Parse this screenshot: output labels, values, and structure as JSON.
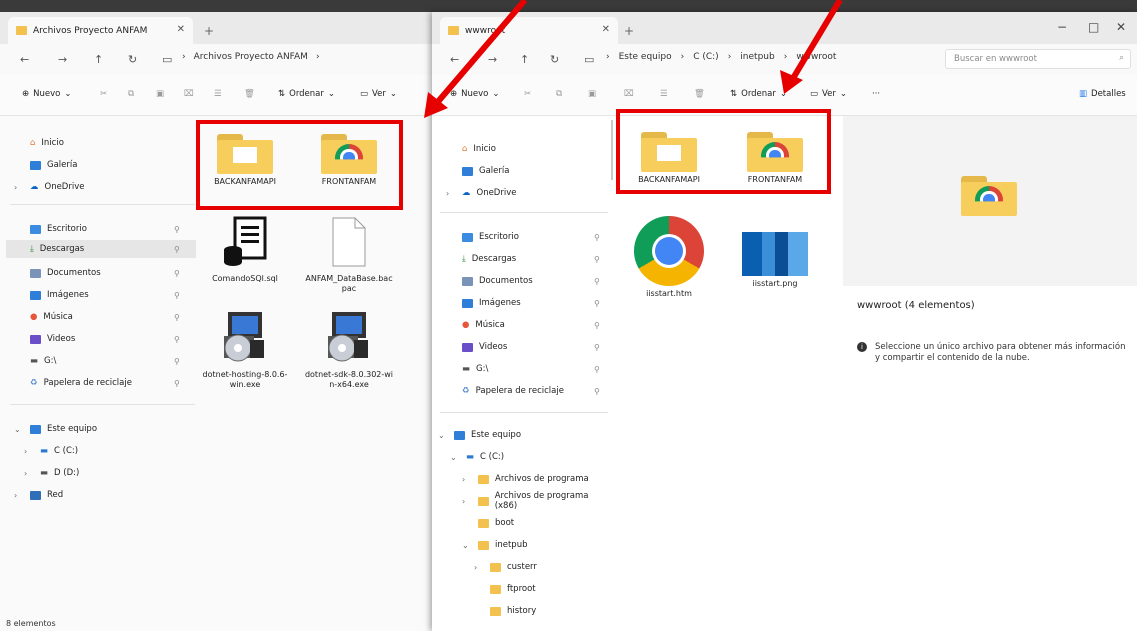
{
  "left_window": {
    "tab_title": "Archivos Proyecto ANFAM",
    "breadcrumb": [
      "Archivos Proyecto ANFAM"
    ],
    "toolbar": {
      "new": "Nuevo",
      "sort": "Ordenar",
      "view": "Ver"
    },
    "nav": {
      "home": "Inicio",
      "gallery": "Galería",
      "onedrive": "OneDrive",
      "desktop": "Escritorio",
      "downloads": "Descargas",
      "documents": "Documentos",
      "images": "Imágenes",
      "music": "Música",
      "videos": "Videos",
      "g_drive": "G:\\",
      "recycle": "Papelera de reciclaje",
      "this_pc": "Este equipo",
      "c_drive": "C (C:)",
      "d_drive": "D (D:)",
      "network": "Red"
    },
    "files": [
      {
        "name": "BACKANFAMAPI",
        "type": "folder"
      },
      {
        "name": "FRONTANFAM",
        "type": "folder-chrome"
      },
      {
        "name": "ComandoSQl.sql",
        "type": "sql"
      },
      {
        "name": "ANFAM_DataBase.bacpac",
        "type": "file"
      },
      {
        "name": "dotnet-hosting-8.0.6-win.exe",
        "type": "installer"
      },
      {
        "name": "dotnet-sdk-8.0.302-win-x64.exe",
        "type": "installer"
      }
    ],
    "status": "8 elementos"
  },
  "right_window": {
    "tab_title": "wwwroot",
    "breadcrumb": [
      "Este equipo",
      "C (C:)",
      "inetpub",
      "wwwroot"
    ],
    "search_placeholder": "Buscar en wwwroot",
    "toolbar": {
      "new": "Nuevo",
      "sort": "Ordenar",
      "view": "Ver",
      "more": "···",
      "details": "Detalles"
    },
    "nav": {
      "home": "Inicio",
      "gallery": "Galería",
      "onedrive": "OneDrive",
      "desktop": "Escritorio",
      "downloads": "Descargas",
      "documents": "Documentos",
      "images": "Imágenes",
      "music": "Música",
      "videos": "Videos",
      "g_drive": "G:\\",
      "recycle": "Papelera de reciclaje",
      "this_pc": "Este equipo",
      "c_drive": "C (C:)",
      "program_files": "Archivos de programa",
      "program_files_x86": "Archivos de programa (x86)",
      "boot": "boot",
      "inetpub": "inetpub",
      "custerr": "custerr",
      "ftproot": "ftproot",
      "history": "history"
    },
    "files": [
      {
        "name": "BACKANFAMAPI",
        "type": "folder"
      },
      {
        "name": "FRONTANFAM",
        "type": "folder-chrome"
      },
      {
        "name": "iisstart.htm",
        "type": "chrome"
      },
      {
        "name": "iisstart.png",
        "type": "image"
      }
    ],
    "details": {
      "title": "wwwroot (4 elementos)",
      "message": "Seleccione un único archivo para obtener más información y compartir el contenido de la nube."
    }
  },
  "colors": {
    "highlight": "#e60000",
    "folder": "#f7cd5c",
    "accent": "#1a73e8"
  }
}
